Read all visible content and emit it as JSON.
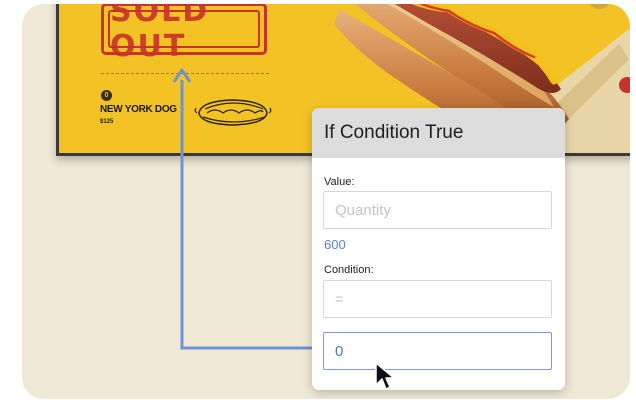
{
  "signage": {
    "stamp_text": "SOLD OUT",
    "badge_number": "0",
    "item_name": "NEW YORK DOG",
    "item_price": "$125"
  },
  "panel": {
    "title": "If Condition True",
    "value_label": "Value:",
    "value_placeholder": "Quantity",
    "value_current": "600",
    "condition_label": "Condition:",
    "condition_placeholder": "=",
    "target_value": "0"
  },
  "colors": {
    "background": "#efe8d4",
    "signage_yellow": "#f3c325",
    "stamp_red": "#c8322a",
    "connector_blue": "#6f93d8",
    "accent_text_blue": "#5b80cf"
  },
  "icons": {
    "cursor": "mouse-pointer-icon",
    "arrow": "arrow-up-icon"
  }
}
